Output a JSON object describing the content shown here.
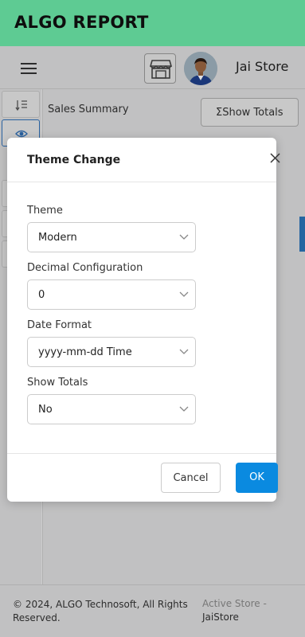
{
  "app": {
    "title": "ALGO REPORT"
  },
  "nav": {
    "store_name": "Jai Store"
  },
  "page": {
    "subtitle": "Sales Summary",
    "show_totals_label": "Show Totals"
  },
  "footer": {
    "copyright": "© 2024, ALGO Technosoft, All Rights Reserved.",
    "active_store_label": "Active Store -",
    "active_store_value": "JaiStore"
  },
  "modal": {
    "title": "Theme Change",
    "fields": [
      {
        "label": "Theme",
        "value": "Modern"
      },
      {
        "label": "Decimal Configuration",
        "value": "0"
      },
      {
        "label": "Date Format",
        "value": "yyyy-mm-dd Time"
      },
      {
        "label": "Show Totals",
        "value": "No"
      }
    ],
    "cancel_label": "Cancel",
    "ok_label": "OK"
  },
  "colors": {
    "app_bar": "#6ce8a8",
    "primary_button": "#0a8ae0",
    "accent_strip": "#2b73b8"
  },
  "icons": {
    "menu": "hamburger-icon",
    "store": "storefront-icon",
    "rail_sort": "sort-list-icon",
    "rail_view": "eye-icon",
    "close": "close-icon",
    "select_caret": "chevron-down-icon"
  }
}
